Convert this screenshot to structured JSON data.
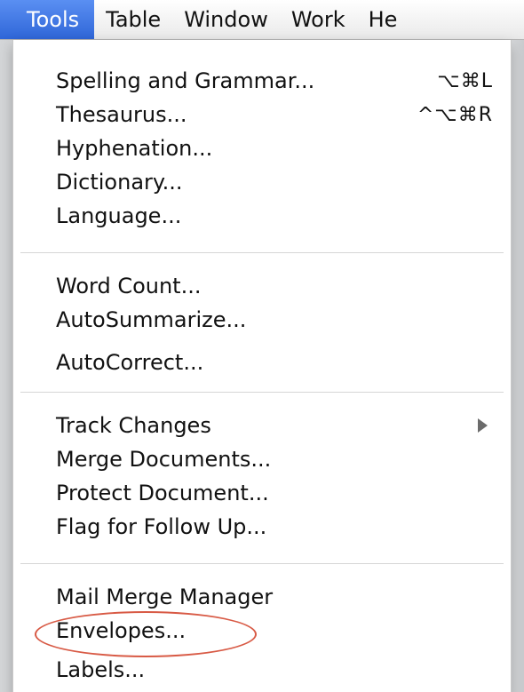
{
  "menubar": {
    "items": [
      {
        "label": "Tools",
        "active": true
      },
      {
        "label": "Table",
        "active": false
      },
      {
        "label": "Window",
        "active": false
      },
      {
        "label": "Work",
        "active": false
      },
      {
        "label": "He",
        "active": false
      }
    ]
  },
  "tools_menu": {
    "groups": [
      {
        "items": [
          {
            "label": "Spelling and Grammar...",
            "shortcut": "⌥⌘L"
          },
          {
            "label": "Thesaurus...",
            "shortcut": "^⌥⌘R"
          },
          {
            "label": "Hyphenation...",
            "shortcut": ""
          },
          {
            "label": "Dictionary...",
            "shortcut": ""
          },
          {
            "label": "Language...",
            "shortcut": ""
          }
        ]
      },
      {
        "items": [
          {
            "label": "Word Count...",
            "shortcut": ""
          },
          {
            "label": "AutoSummarize...",
            "shortcut": ""
          },
          {
            "label": "AutoCorrect...",
            "shortcut": ""
          }
        ]
      },
      {
        "items": [
          {
            "label": "Track Changes",
            "shortcut": "",
            "submenu": true
          },
          {
            "label": "Merge Documents...",
            "shortcut": ""
          },
          {
            "label": "Protect Document...",
            "shortcut": ""
          },
          {
            "label": "Flag for Follow Up...",
            "shortcut": ""
          }
        ]
      },
      {
        "items": [
          {
            "label": "Mail Merge Manager",
            "shortcut": ""
          },
          {
            "label": "Envelopes...",
            "shortcut": "",
            "highlighted_annotation": true
          },
          {
            "label": "Labels...",
            "shortcut": ""
          }
        ]
      }
    ]
  },
  "colors": {
    "menubar_active_bg": "#2f66d8",
    "annotation_oval": "#d85a45",
    "submenu_arrow": "#6b6b6b"
  },
  "icons": {
    "submenu_arrow": "triangle-right-icon"
  }
}
